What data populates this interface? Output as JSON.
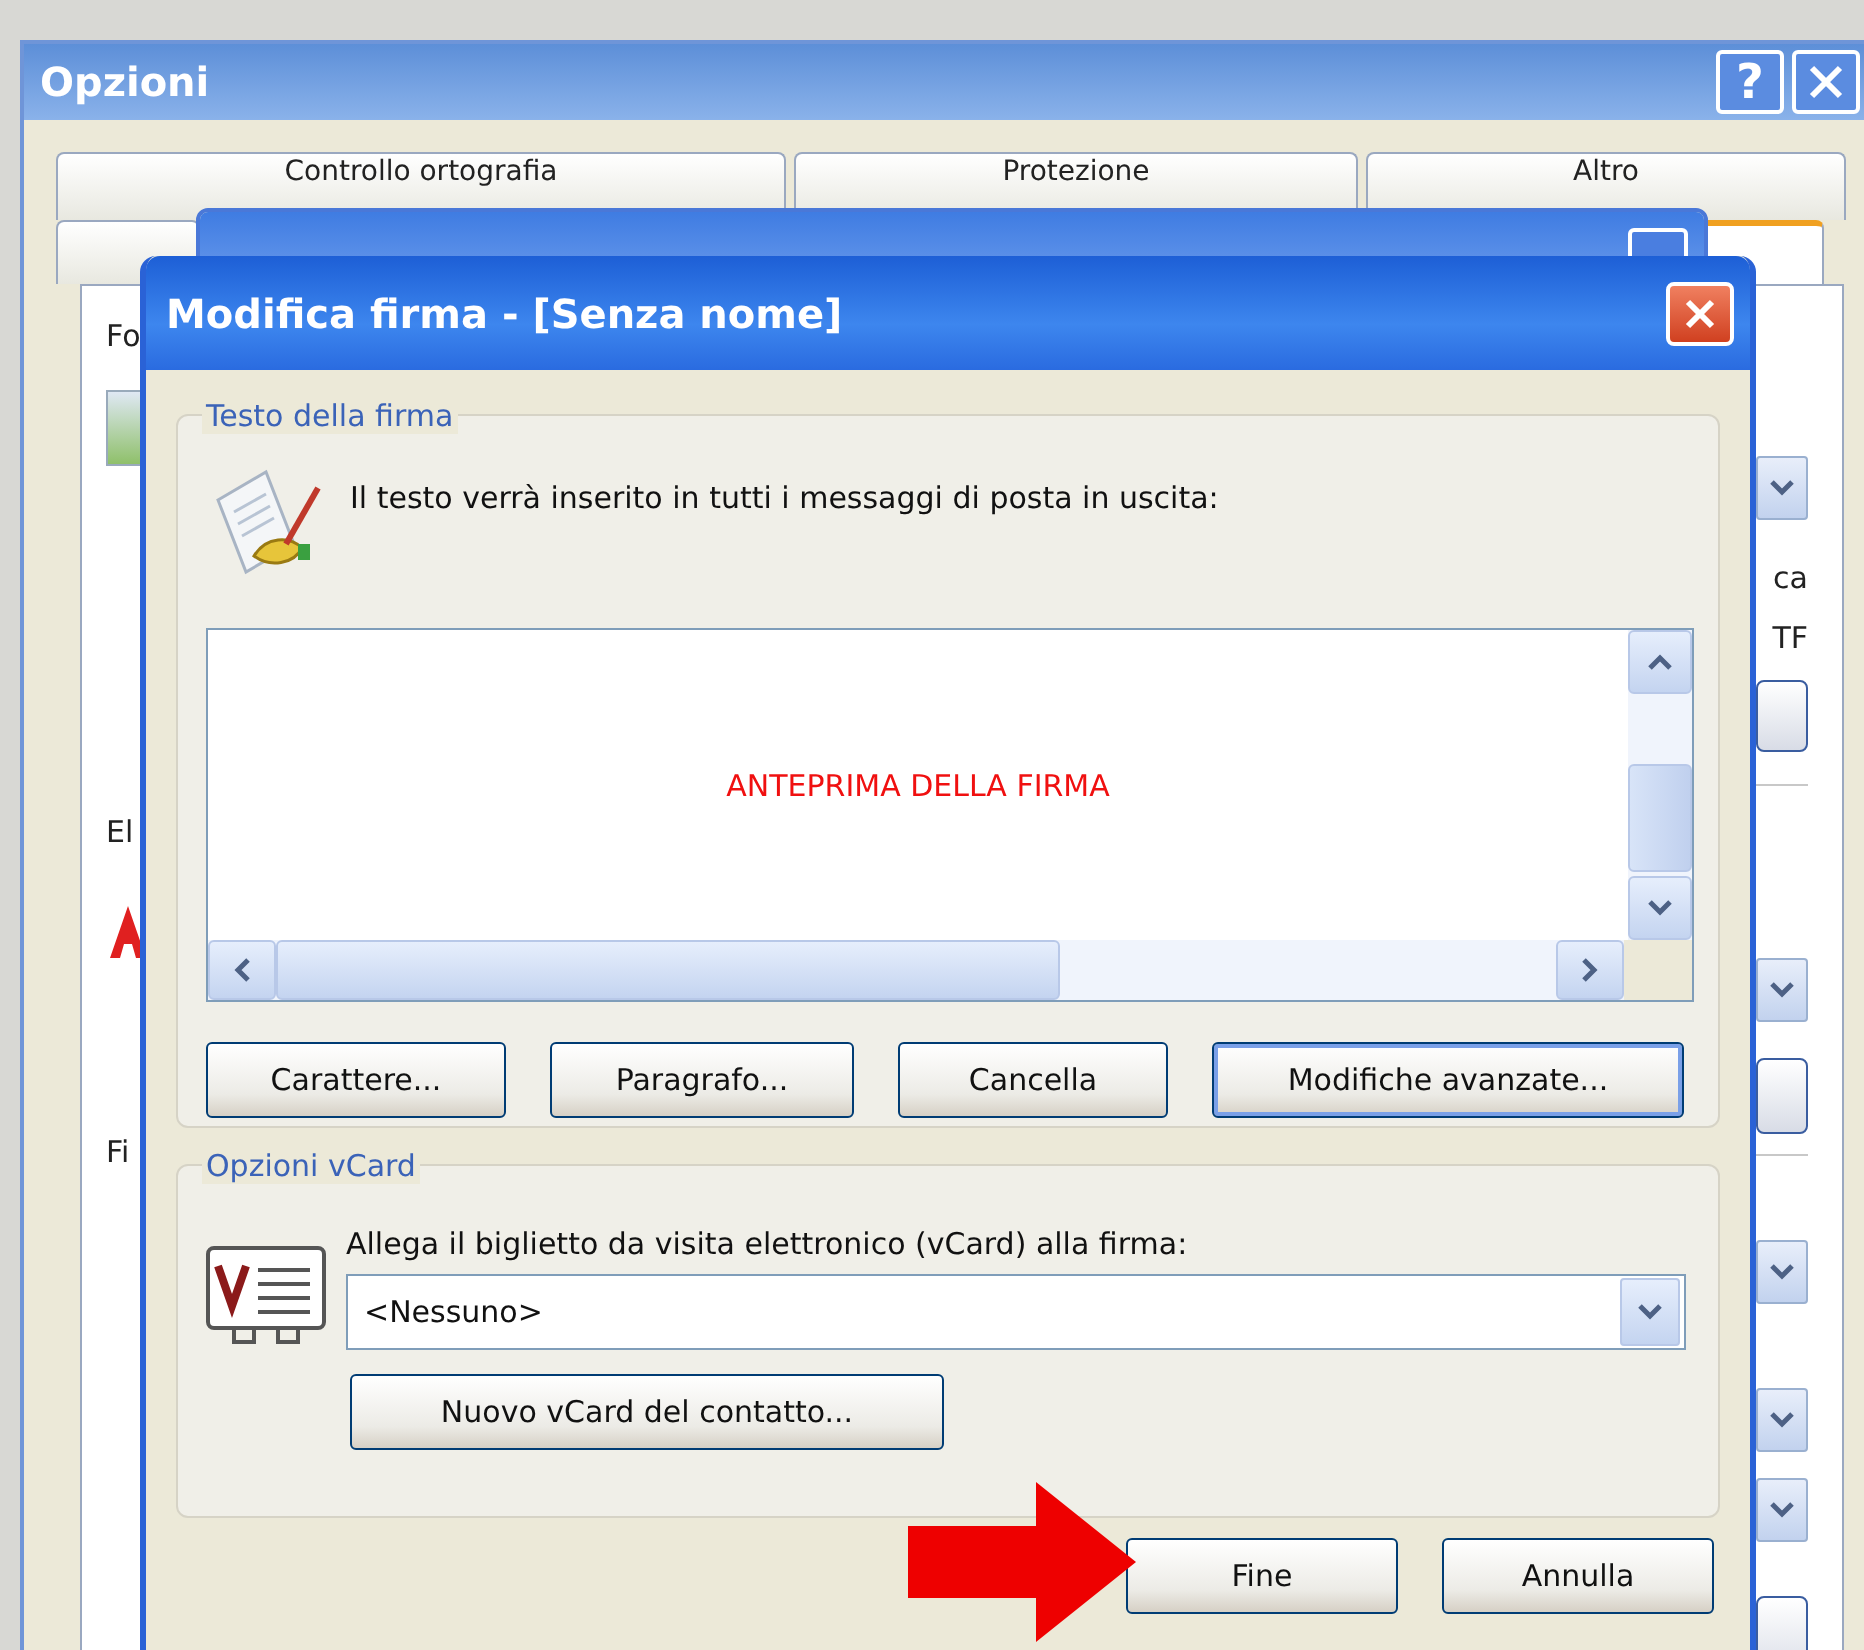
{
  "window": {
    "title": "Opzioni"
  },
  "title_buttons": [
    {
      "kind": "help",
      "label": "?"
    },
    {
      "kind": "close"
    }
  ],
  "tabs": [
    {
      "label": "Controllo ortografia",
      "selected": false
    },
    {
      "label": "Protezione",
      "selected": false
    },
    {
      "label": "Altro",
      "selected": false
    }
  ],
  "background_fragments": {
    "left": [
      "Fo",
      "El",
      "Fi"
    ],
    "right": [
      "ca",
      "TF"
    ]
  },
  "dialog": {
    "title": "Modifica firma - [Senza nome]",
    "signature_group": {
      "legend": "Testo della firma",
      "hint": "Il testo verrà inserito in tutti i messaggi di posta in uscita:",
      "preview": "ANTEPRIMA DELLA FIRMA",
      "buttons": [
        {
          "label": "Carattere...",
          "focused": false
        },
        {
          "label": "Paragrafo...",
          "focused": false
        },
        {
          "label": "Cancella",
          "focused": false
        },
        {
          "label": "Modifiche avanzate...",
          "focused": true
        }
      ]
    },
    "vcard_group": {
      "legend": "Opzioni vCard",
      "label": "Allega il biglietto da visita elettronico (vCard) alla firma:",
      "select": "<Nessuno>",
      "button": "Nuovo vCard del contatto..."
    },
    "buttons": [
      {
        "label": "Fine",
        "focused": false
      },
      {
        "label": "Annulla",
        "focused": false
      }
    ]
  }
}
